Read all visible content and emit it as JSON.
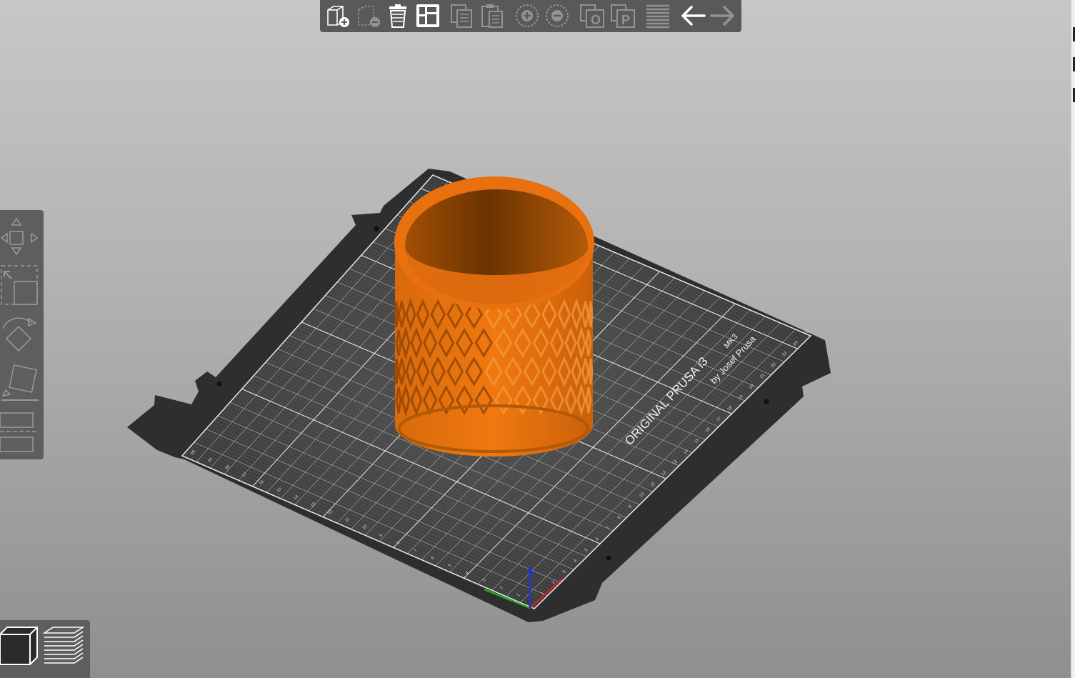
{
  "window": {
    "title": ""
  },
  "bed": {
    "brand_line": "ORIGINAL PRUSA i3",
    "model": "MK3",
    "credit": "by Josef Prusa",
    "x_ticks": [
      "1",
      "2",
      "3",
      "4",
      "5",
      "6",
      "7",
      "8",
      "9",
      "10",
      "11",
      "12",
      "13",
      "14",
      "15",
      "16",
      "17",
      "18",
      "19",
      "20",
      "21",
      "22",
      "23",
      "24",
      "25"
    ],
    "y_ticks": [
      "1",
      "2",
      "3",
      "4",
      "5",
      "6",
      "7",
      "8",
      "9",
      "10",
      "11",
      "12",
      "13",
      "14",
      "15",
      "16",
      "17",
      "18",
      "19",
      "20"
    ]
  },
  "colors": {
    "model": "#e8700f",
    "bed": "#3a3a3a",
    "toolbar": "#595959",
    "axis_x": "#cc2222",
    "axis_y": "#22aa22",
    "axis_z": "#2233cc"
  },
  "toolbar": {
    "items": [
      {
        "icon": "add-object-icon",
        "enabled": true
      },
      {
        "icon": "delete-object-icon",
        "enabled": false
      },
      {
        "icon": "delete-all-icon",
        "enabled": true
      },
      {
        "icon": "arrange-icon",
        "enabled": true
      },
      {
        "icon": "copy-icon",
        "enabled": false
      },
      {
        "icon": "paste-icon",
        "enabled": false
      },
      {
        "icon": "add-instance-icon",
        "enabled": false
      },
      {
        "icon": "remove-instance-icon",
        "enabled": false
      },
      {
        "icon": "split-objects-icon",
        "enabled": false
      },
      {
        "icon": "split-parts-icon",
        "enabled": false
      },
      {
        "icon": "layers-editing-icon",
        "enabled": false
      },
      {
        "icon": "undo-icon",
        "enabled": true
      },
      {
        "icon": "redo-icon",
        "enabled": false
      }
    ]
  },
  "side_toolbar": {
    "items": [
      {
        "icon": "move-icon"
      },
      {
        "icon": "scale-icon"
      },
      {
        "icon": "rotate-icon"
      },
      {
        "icon": "place-on-face-icon"
      },
      {
        "icon": "cut-icon"
      }
    ]
  },
  "view_switch": {
    "items": [
      {
        "icon": "3d-view-icon",
        "active": true
      },
      {
        "icon": "preview-layers-icon",
        "active": false
      }
    ]
  }
}
